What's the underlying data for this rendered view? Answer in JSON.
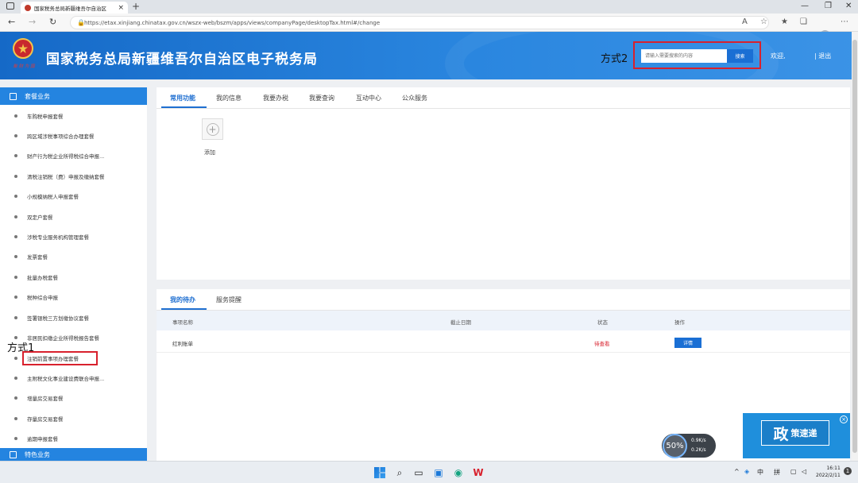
{
  "browser": {
    "tab_title": "国家税务总局新疆维吾尔自治区",
    "tab_close": "×",
    "new_tab": "+",
    "url": "https://etax.xinjiang.chinatax.gov.cn/wszx-web/bszm/apps/views/companyPage/desktopTax.html#/change"
  },
  "header": {
    "site_title": "国家税务总局新疆维吾尔自治区电子税务局",
    "emblem_motto": "聚 财 为 国",
    "search_placeholder": "请输入需要搜索的内容",
    "search_button": "搜索",
    "welcome": "欢迎,",
    "logout": "| 退出"
  },
  "annotations": {
    "method2": "方式2",
    "method1": "方式1"
  },
  "sidebar": {
    "section1": "套餐业务",
    "items": [
      {
        "label": "车购税申报套餐"
      },
      {
        "label": "跨区域涉税事项综合办理套餐"
      },
      {
        "label": "财产行为税企业所得税综合申报..."
      },
      {
        "label": "清税注销税（费）申报及缴纳套餐"
      },
      {
        "label": "小规模纳税人申报套餐"
      },
      {
        "label": "双定户套餐"
      },
      {
        "label": "涉税专业服务机构管理套餐"
      },
      {
        "label": "发票套餐"
      },
      {
        "label": "批量办税套餐"
      },
      {
        "label": "税种综合申报"
      },
      {
        "label": "签署银税三方划缴协议套餐"
      },
      {
        "label": "非居民扣缴企业所得税报告套餐"
      },
      {
        "label": "注销前置事项办理套餐"
      },
      {
        "label": "主附税文化事业建设费联合申报..."
      },
      {
        "label": "增量房交易套餐"
      },
      {
        "label": "存量房交易套餐"
      },
      {
        "label": "逾期申报套餐"
      }
    ],
    "section2": "特色业务"
  },
  "panel1": {
    "tabs": [
      "常用功能",
      "我的信息",
      "我要办税",
      "我要查询",
      "互动中心",
      "公众服务"
    ],
    "add_icon": "+",
    "add_label": "添加"
  },
  "panel2": {
    "tabs": [
      "我的待办",
      "服务提醒"
    ],
    "columns": [
      "事项名称",
      "截止日期",
      "状态",
      "操作"
    ],
    "rows": [
      {
        "name": "红利账单",
        "deadline": "",
        "status": "待查看",
        "action": "详情"
      }
    ]
  },
  "widgets": {
    "speed_percent": "50%",
    "speed_up": "0.9K/s",
    "speed_down": "0.2K/s",
    "promo_big": "政",
    "promo_small": "策速递",
    "promo_close": "×"
  },
  "taskbar": {
    "ime_lang": "中",
    "ime_mode": "拼",
    "time": "16:11",
    "date": "2022/2/11"
  },
  "colors": {
    "header_blue": "#1569c7",
    "sidebar_head": "#2484e0",
    "highlight_red": "#d8212d",
    "active_tab": "#1f6fd1"
  }
}
